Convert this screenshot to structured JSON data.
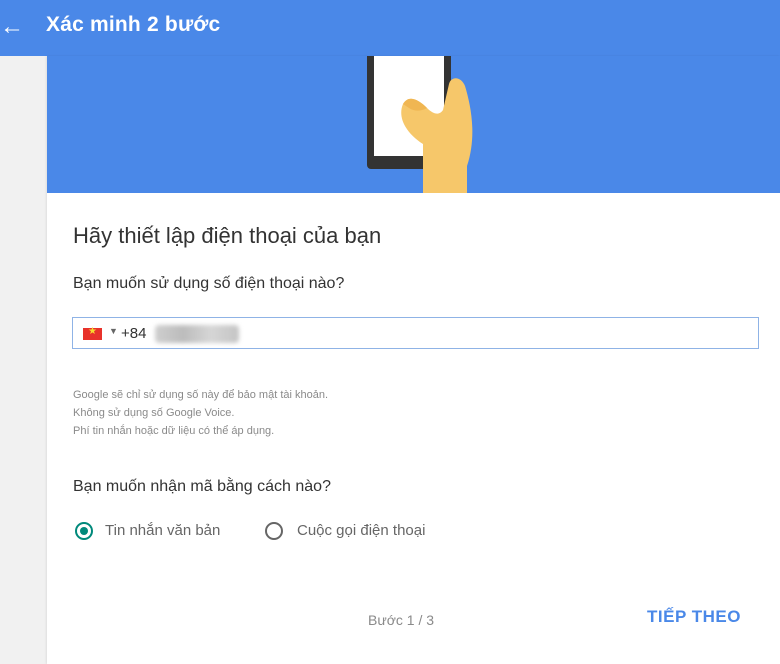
{
  "header": {
    "back_icon": "arrow-left-icon",
    "title": "Xác minh 2 bước",
    "accent": "#4a88e8"
  },
  "main": {
    "heading": "Hãy thiết lập điện thoại của bạn",
    "phone_question": "Bạn muốn sử dụng số điện thoại nào?",
    "phone": {
      "country_flag_icon": "vietnam-flag-icon",
      "country_code": "+84",
      "number_redacted": true
    },
    "notes": [
      "Google sẽ chỉ sử dụng số này để bảo mật tài khoản.",
      "Không sử dụng số Google Voice.",
      "Phí tin nhắn hoặc dữ liệu có thể áp dụng."
    ],
    "method_question": "Bạn muốn nhận mã bằng cách nào?",
    "methods": [
      {
        "label": "Tin nhắn văn bản",
        "selected": true
      },
      {
        "label": "Cuộc gọi điện thoại",
        "selected": false
      }
    ],
    "selected_color": "#00897b"
  },
  "footer": {
    "step": "Bước 1 / 3",
    "next_label": "TIẾP THEO"
  }
}
